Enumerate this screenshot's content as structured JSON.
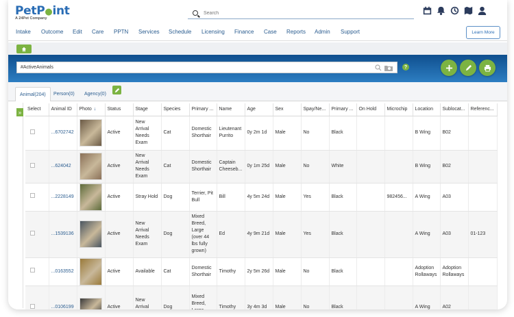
{
  "logo": {
    "main_a": "Pet",
    "main_b": "P",
    "main_c": "int",
    "sub": "A 24Pet Company"
  },
  "search": {
    "placeholder": "Search"
  },
  "top_icons": [
    "calendar-icon",
    "bell-icon",
    "history-icon",
    "map-icon",
    "user-icon"
  ],
  "nav": {
    "items": [
      "Intake",
      "Outcome",
      "Edit",
      "Care",
      "PPTN",
      "Services",
      "Schedule",
      "Licensing",
      "Finance",
      "Case",
      "Reports",
      "Admin",
      "Support"
    ],
    "learn_more": "Learn More"
  },
  "filter": {
    "value": "#ActiveAnimals"
  },
  "help_label": "?",
  "tabs": [
    {
      "label": "Animal(204)"
    },
    {
      "label": "Person(0)"
    },
    {
      "label": "Agency(0)"
    }
  ],
  "expand_label": "»",
  "columns": [
    "Select",
    "Animal ID",
    "Photo",
    "Status",
    "Stage",
    "Species",
    "Primary ...",
    "Name",
    "Age",
    "Sex",
    "Spay/Ne...",
    "Primary ...",
    "On Hold",
    "Microchip",
    "Location",
    "Sublocat...",
    "Referenc..."
  ],
  "sort_indicator": "↓",
  "rows": [
    {
      "id": "...6702742",
      "status": "Active",
      "stage": "New Arrival Needs Exam",
      "species": "Cat",
      "breed": "Domestic Shorthair",
      "name": "Lieutenant Purrito",
      "age": "0y 2m 1d",
      "sex": "Male",
      "spay": "No",
      "color": "Black",
      "hold": "",
      "chip": "",
      "location": "B Wing",
      "subloc": "B02",
      "ref": ""
    },
    {
      "id": "...624042",
      "status": "Active",
      "stage": "New Arrival Needs Exam",
      "species": "Cat",
      "breed": "Domestic Shorthair",
      "name": "Captain Cheeseb...",
      "age": "0y 1m 25d",
      "sex": "Male",
      "spay": "No",
      "color": "White",
      "hold": "",
      "chip": "",
      "location": "B Wing",
      "subloc": "B02",
      "ref": ""
    },
    {
      "id": "...2228149",
      "status": "Active",
      "stage": "Stray Hold",
      "species": "Dog",
      "breed": "Terrier, Pit Bull",
      "name": "Bill",
      "age": "4y 5m 24d",
      "sex": "Male",
      "spay": "Yes",
      "color": "Black",
      "hold": "",
      "chip": "982456...",
      "location": "A Wing",
      "subloc": "A03",
      "ref": ""
    },
    {
      "id": "...1539136",
      "status": "Active",
      "stage": "New Arrival Needs Exam",
      "species": "Dog",
      "breed": "Mixed Breed, Large (over 44 lbs fully grown)",
      "name": "Ed",
      "age": "4y 9m 21d",
      "sex": "Male",
      "spay": "Yes",
      "color": "Black",
      "hold": "",
      "chip": "",
      "location": "A Wing",
      "subloc": "A03",
      "ref": "01-123"
    },
    {
      "id": "...0163552",
      "status": "Active",
      "stage": "Available",
      "species": "Cat",
      "breed": "Domestic Shorthair",
      "name": "Timothy",
      "age": "2y 5m 26d",
      "sex": "Male",
      "spay": "No",
      "color": "Black",
      "hold": "",
      "chip": "",
      "location": "Adoption Rollaways",
      "subloc": "Adoption Rollaways",
      "ref": ""
    },
    {
      "id": "...0106199",
      "status": "Active",
      "stage": "New Arrival Needs",
      "species": "Dog",
      "breed": "Mixed Breed, Large (over 44",
      "name": "Timothy",
      "age": "3y 4m 3d",
      "sex": "Male",
      "spay": "No",
      "color": "Black",
      "hold": "",
      "chip": "",
      "location": "A Wing",
      "subloc": "A02",
      "ref": ""
    }
  ],
  "colors": {
    "accent_green": "#7cb342",
    "brand_blue": "#2a6db5",
    "band_dark": "#0f4f8e"
  }
}
